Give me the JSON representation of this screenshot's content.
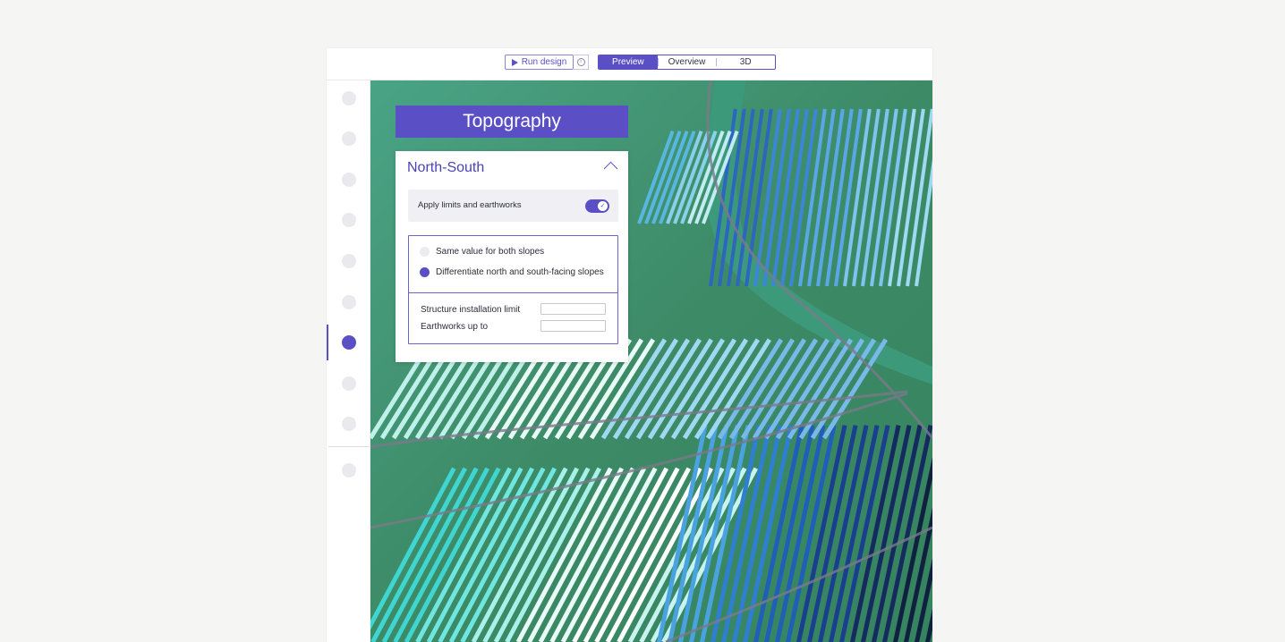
{
  "toolbar": {
    "run_label": "Run design",
    "info_icon": "info-icon",
    "play_icon": "play-icon"
  },
  "tabs": [
    {
      "label": "Preview",
      "active": true
    },
    {
      "label": "Overview",
      "active": false
    },
    {
      "label": "3D",
      "active": false
    }
  ],
  "sidebar": {
    "step_count": 10,
    "active_step": 7
  },
  "panel": {
    "banner_title": "Topography",
    "section_title": "North-South",
    "toggle_label": "Apply limits and earthworks",
    "toggle_on": true,
    "radio_options": [
      {
        "label": "Same value for both slopes",
        "selected": false
      },
      {
        "label": "Differentiate north and south-facing slopes",
        "selected": true
      }
    ],
    "fields": [
      {
        "label": "Structure installation limit",
        "value": ""
      },
      {
        "label": "Earthworks up to",
        "value": ""
      }
    ]
  },
  "colors": {
    "accent": "#5a4fc4",
    "terrain": "#3f8a67"
  }
}
